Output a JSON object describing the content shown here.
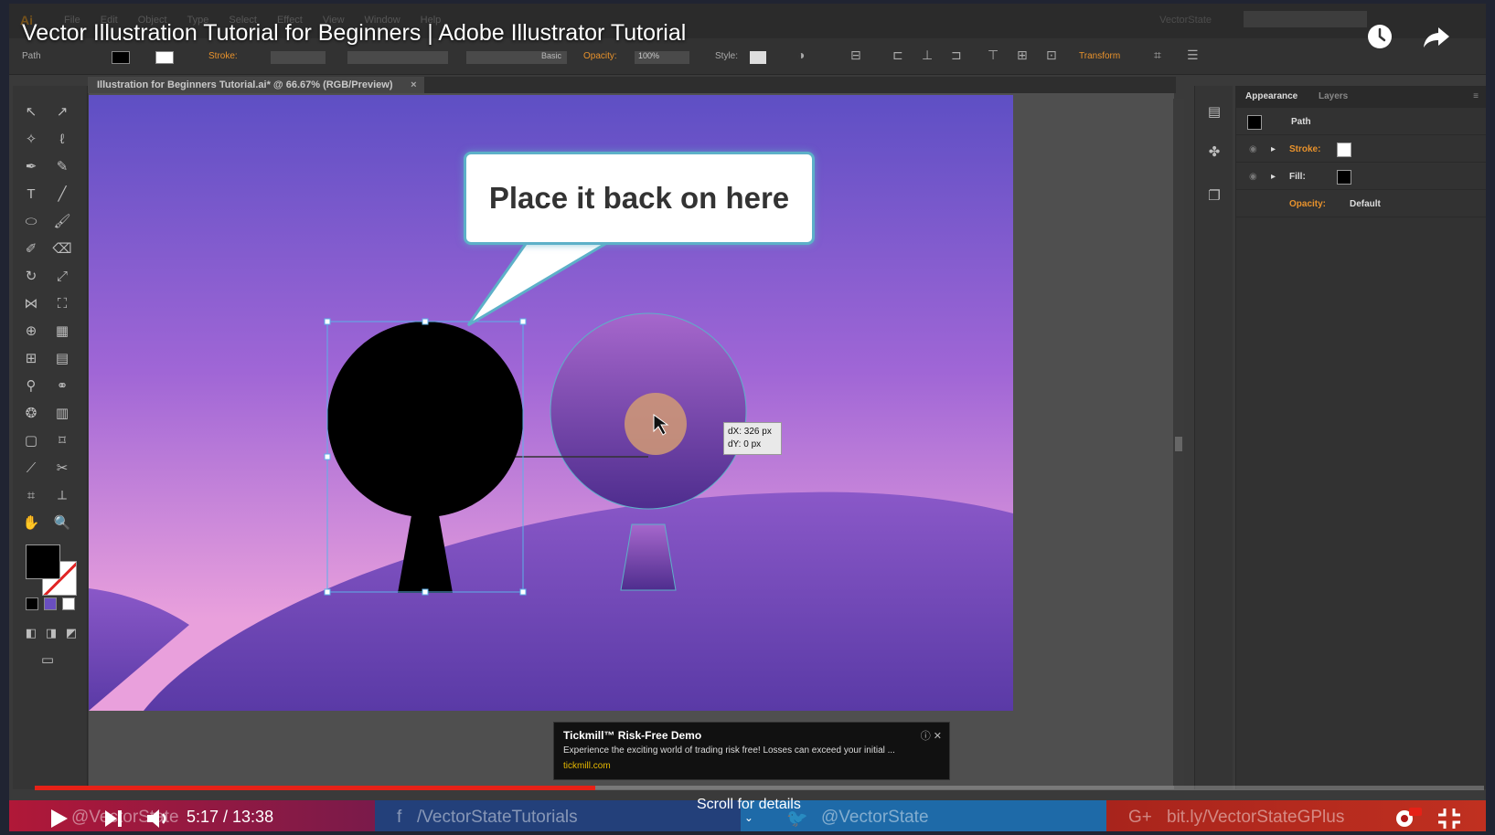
{
  "video": {
    "title": "Vector Illustration Tutorial for Beginners | Adobe Illustrator Tutorial",
    "current_time": "5:17",
    "duration": "13:38",
    "time_display": "5:17 / 13:38",
    "progress": 0.387,
    "scroll_hint": "Scroll for details",
    "callout": "Place it back on here",
    "watermarks": {
      "channel": "@VectorState",
      "facebook": "/VectorStateTutorials",
      "twitter": "@VectorState",
      "gplus": "bit.ly/VectorStateGPlus"
    }
  },
  "illustrator": {
    "app_logo": "Ai",
    "menus": [
      "File",
      "Edit",
      "Object",
      "Type",
      "Select",
      "Effect",
      "View",
      "Window",
      "Help"
    ],
    "workspace": "VectorState",
    "control_bar": {
      "selection_label": "Path",
      "stroke_label": "Stroke:",
      "brush_label": "Basic",
      "opacity_label": "Opacity:",
      "opacity_value": "100%",
      "style_label": "Style:",
      "transform_label": "Transform"
    },
    "document_tab": "Illustration for Beginners Tutorial.ai* @ 66.67% (RGB/Preview)",
    "document_tab_close": "×",
    "measure_tooltip": {
      "dx": "dX: 326 px",
      "dy": "dY: 0 px"
    },
    "panels": {
      "tabs": [
        "Appearance",
        "Layers"
      ],
      "object": "Path",
      "rows": [
        {
          "label": "Stroke:",
          "highlight": true
        },
        {
          "label": "Fill:",
          "highlight": false
        },
        {
          "label": "Opacity:",
          "value": "Default",
          "highlight": true
        }
      ]
    }
  },
  "ad": {
    "title": "Tickmill™ Risk-Free Demo",
    "description": "Experience the exciting world of trading risk free! Losses can exceed your initial ...",
    "url": "tickmill.com",
    "close": "ⓘ ✕"
  },
  "colors": {
    "sky_top": "#5e4fc4",
    "sky_mid": "#a066d6",
    "sky_bottom": "#e9a0dc",
    "hill": "#7d4fc0",
    "progress": "#e62117",
    "accent_orange": "#e8922c"
  }
}
